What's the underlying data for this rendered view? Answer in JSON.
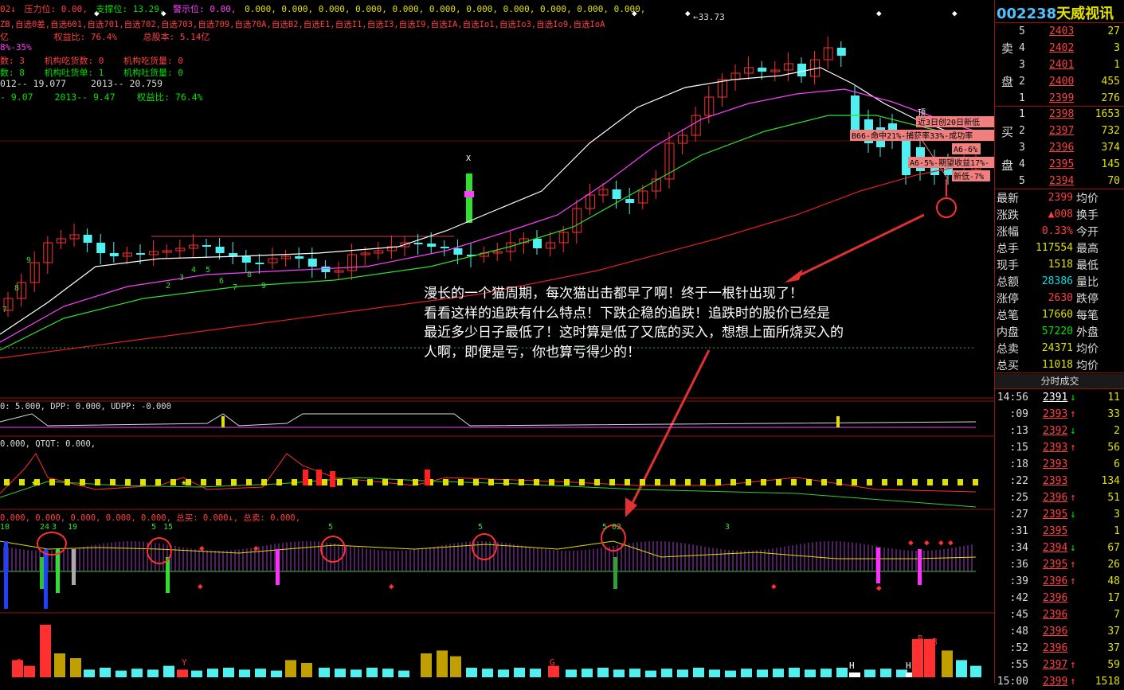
{
  "header": {
    "line1": [
      {
        "text": "02↓",
        "color": "#ff4040"
      },
      {
        "text": "压力位: 0.00,",
        "color": "#ff4040"
      },
      {
        "text": "支撑位: 13.29,",
        "color": "#00e000"
      },
      {
        "text": "警示位: 0.00,",
        "color": "#ff40ff"
      },
      {
        "text": "0.000, 0.000, 0.000, 0.000, 0.000, 0.000, 0.000, 0.000, 0.000, 0.000, 0.000,",
        "color": "#e0e000"
      }
    ],
    "line2": "ZB,自选0差,自选601,自选701,自选702,自选703,自选709,自选70A,自选B2,自选E1,自选I1,自选I3,自选I9,自选IA,自选Io1,自选Io3,自选Io9,自选IoA",
    "line3": [
      {
        "text": "亿",
        "color": "#ff4040"
      },
      {
        "text": "权益比: 76.4%",
        "color": "#ff4040"
      },
      {
        "text": "总股本: 5.14亿",
        "color": "#ff4040"
      }
    ],
    "line4": "8%-35%",
    "line5": [
      {
        "text": "数: 3",
        "color": "#ff4040"
      },
      {
        "text": "机构吃货数: 0",
        "color": "#ff4040"
      },
      {
        "text": "机构吃货量: 0",
        "color": "#ff4040"
      }
    ],
    "line6": [
      {
        "text": "数: 8",
        "color": "#00e000"
      },
      {
        "text": "机构吐货单: 1",
        "color": "#00e000"
      },
      {
        "text": "机构吐货量: 0",
        "color": "#00e000"
      }
    ],
    "line7": [
      {
        "text": "012-- 19.077",
        "color": "#ddd"
      },
      {
        "text": "2013-- 20.759",
        "color": "#ddd"
      }
    ],
    "line8": [
      {
        "text": "- 9.07",
        "color": "#00e000"
      },
      {
        "text": "2013-- 9.47",
        "color": "#00e000"
      },
      {
        "text": "权益比: 76.4%",
        "color": "#00e000"
      }
    ]
  },
  "price_high_label": "33.73",
  "candle_labels": [
    "9",
    "8",
    "7",
    "2",
    "3",
    "4",
    "5",
    "6",
    "7",
    "8",
    "9",
    "X"
  ],
  "event_labels": [
    "近3日创20日新低",
    "B66-命中21%-捕获率33%-成功率",
    "A6-6%",
    "A6-5%-期望收益17%-",
    "新低-7%",
    "顶"
  ],
  "annotation": [
    "漫长的一个猫周期，每次猫出击都早了啊！终于一根针出现了！",
    "看看这样的追跌有什么特点！下跌企稳的追跌！追跌时的股价已经是",
    "最近多少日子最低了！这时算是低了又底的买入，想想上面所烧买入的",
    "人啊，即便是亏，你也算亏得少的！"
  ],
  "indicators": {
    "ind1": "0: 5.000, DPP: 0.000, UDPP: -0.000",
    "ind2": "0.000, QTQT: 0.000,",
    "ind3": "0.000, 0.000, 0.000, 0.000, 0.000, 总买: 0.000↓, 总卖: 0.000,",
    "ind3_labels": [
      "10",
      "24",
      "3",
      "19",
      "5",
      "15",
      "5",
      "5",
      "5",
      "02",
      "3",
      "4",
      "4",
      "8",
      "8",
      "3",
      "0",
      "0",
      "3",
      "0",
      "7",
      "4",
      "4",
      "9",
      "30",
      "3",
      "30",
      "A"
    ],
    "vol_labels": [
      "G",
      "B",
      "Y",
      "G",
      "H",
      "H",
      "B",
      "B"
    ]
  },
  "quote": {
    "code": "002238",
    "name": "天威视讯",
    "sell_label": [
      "卖",
      "盘"
    ],
    "buy_label": [
      "买",
      "盘"
    ],
    "asks": [
      {
        "level": "5",
        "price": "2403",
        "vol": "27"
      },
      {
        "level": "4",
        "price": "2402",
        "vol": "3"
      },
      {
        "level": "3",
        "price": "2401",
        "vol": "1"
      },
      {
        "level": "2",
        "price": "2400",
        "vol": "455"
      },
      {
        "level": "1",
        "price": "2399",
        "vol": "276"
      }
    ],
    "bids": [
      {
        "level": "1",
        "price": "2398",
        "vol": "1653"
      },
      {
        "level": "2",
        "price": "2397",
        "vol": "732"
      },
      {
        "level": "3",
        "price": "2396",
        "vol": "374"
      },
      {
        "level": "4",
        "price": "2395",
        "vol": "145"
      },
      {
        "level": "5",
        "price": "2394",
        "vol": "70"
      }
    ],
    "stats": [
      {
        "k1": "最新",
        "v1": "2399",
        "c1": "#ff4040",
        "k2": "均价",
        "v2": ""
      },
      {
        "k1": "涨跌",
        "v1": "▲008",
        "c1": "#ff4040",
        "k2": "换手",
        "v2": ""
      },
      {
        "k1": "涨幅",
        "v1": "0.33%",
        "c1": "#ff4040",
        "k2": "今开",
        "v2": ""
      },
      {
        "k1": "总手",
        "v1": "117554",
        "c1": "#e0e000",
        "k2": "最高",
        "v2": ""
      },
      {
        "k1": "现手",
        "v1": "1518",
        "c1": "#e0e000",
        "k2": "最低",
        "v2": ""
      },
      {
        "k1": "总额",
        "v1": "28386",
        "c1": "#00e0e0",
        "k2": "量比",
        "v2": ""
      },
      {
        "k1": "涨停",
        "v1": "2630",
        "c1": "#ff4040",
        "k2": "跌停",
        "v2": ""
      },
      {
        "k1": "总笔",
        "v1": "17660",
        "c1": "#e0e000",
        "k2": "每笔",
        "v2": ""
      },
      {
        "k1": "内盘",
        "v1": "57220",
        "c1": "#00e000",
        "k2": "外盘",
        "v2": ""
      },
      {
        "k1": "总卖",
        "v1": "24371",
        "c1": "#e0e000",
        "k2": "均价",
        "v2": ""
      },
      {
        "k1": "总买",
        "v1": "11018",
        "c1": "#e0e000",
        "k2": "均价",
        "v2": ""
      }
    ],
    "ticks_title": "分时成交",
    "ticks": [
      {
        "time": "14:56",
        "price": "2391",
        "dir": "↓",
        "vol": "11",
        "pc": "#fff"
      },
      {
        "time": ":09",
        "price": "2393",
        "dir": "↑",
        "vol": "33",
        "pc": "#ff4040"
      },
      {
        "time": ":13",
        "price": "2392",
        "dir": "↓",
        "vol": "2",
        "pc": "#ff4040"
      },
      {
        "time": ":15",
        "price": "2393",
        "dir": "↑",
        "vol": "56",
        "pc": "#ff4040"
      },
      {
        "time": ":18",
        "price": "2393",
        "dir": "",
        "vol": "6",
        "pc": "#ff4040"
      },
      {
        "time": ":22",
        "price": "2393",
        "dir": "",
        "vol": "134",
        "pc": "#ff4040"
      },
      {
        "time": ":25",
        "price": "2396",
        "dir": "↑",
        "vol": "51",
        "pc": "#ff4040"
      },
      {
        "time": ":27",
        "price": "2395",
        "dir": "↓",
        "vol": "3",
        "pc": "#ff4040"
      },
      {
        "time": ":31",
        "price": "2395",
        "dir": "",
        "vol": "1",
        "pc": "#ff4040"
      },
      {
        "time": ":34",
        "price": "2394",
        "dir": "↓",
        "vol": "67",
        "pc": "#ff4040"
      },
      {
        "time": ":36",
        "price": "2395",
        "dir": "↑",
        "vol": "26",
        "pc": "#ff4040"
      },
      {
        "time": ":39",
        "price": "2396",
        "dir": "↑",
        "vol": "48",
        "pc": "#ff4040"
      },
      {
        "time": ":42",
        "price": "2396",
        "dir": "",
        "vol": "17",
        "pc": "#ff4040"
      },
      {
        "time": ":45",
        "price": "2396",
        "dir": "",
        "vol": "7",
        "pc": "#ff4040"
      },
      {
        "time": ":48",
        "price": "2396",
        "dir": "",
        "vol": "37",
        "pc": "#ff4040"
      },
      {
        "time": ":52",
        "price": "2396",
        "dir": "",
        "vol": "37",
        "pc": "#ff4040"
      },
      {
        "time": ":55",
        "price": "2397",
        "dir": "↑",
        "vol": "59",
        "pc": "#ff4040"
      },
      {
        "time": "15:00",
        "price": "2399",
        "dir": "↑",
        "vol": "1518",
        "pc": "#ff4040"
      }
    ]
  },
  "colors": {
    "up": "#ff3030",
    "down": "#50f0f0",
    "ma5": "#ffffff",
    "ma10": "#ff40ff",
    "ma20": "#30e030",
    "ma60": "#e02020",
    "panel_border": "#9a1010",
    "arrow": "#e03030"
  }
}
